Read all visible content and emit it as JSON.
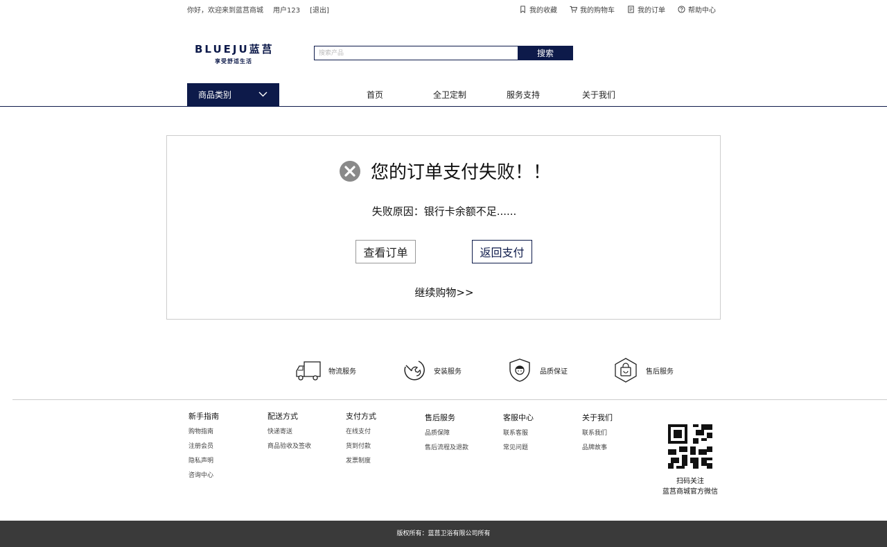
{
  "topbar": {
    "greeting": "你好，欢迎来到蓝莒商城",
    "username": "用户123",
    "logout": "[退出]",
    "favorites": "我的收藏",
    "cart": "我的购物车",
    "orders": "我的订单",
    "help": "帮助中心"
  },
  "logo": {
    "brand": "BLUEJU蓝莒",
    "slogan": "享受舒适生活"
  },
  "search": {
    "placeholder": "搜索产品",
    "button": "搜索"
  },
  "nav": {
    "category": "商品类别",
    "items": [
      "首页",
      "全卫定制",
      "服务支持",
      "关于我们"
    ]
  },
  "result": {
    "title": "您的订单支付失败！！",
    "reason": "失败原因：银行卡余额不足......",
    "view_order": "查看订单",
    "back_to_pay": "返回支付",
    "continue": "继续购物>>"
  },
  "services": [
    "物流服务",
    "安装服务",
    "品质保证",
    "售后服务"
  ],
  "footer": {
    "columns": [
      {
        "head": "新手指南",
        "items": [
          "购物指南",
          "注册会员",
          "隐私声明",
          "咨询中心"
        ]
      },
      {
        "head": "配送方式",
        "items": [
          "快递寄送",
          "商品验收及签收"
        ]
      },
      {
        "head": "支付方式",
        "items": [
          "在线支付",
          "货到付款",
          "发票制度"
        ]
      },
      {
        "head": "售后服务",
        "items": [
          "品质保障",
          "售后流程及退款"
        ]
      },
      {
        "head": "客服中心",
        "items": [
          "联系客服",
          "常见问题"
        ]
      },
      {
        "head": "关于我们",
        "items": [
          "联系我们",
          "品牌故事"
        ]
      }
    ],
    "qr_line1": "扫码关注",
    "qr_line2": "蓝莒商城官方微信",
    "copyright": "版权所有：蓝莒卫浴有限公司所有"
  },
  "colors": {
    "brand": "#0d1a4a",
    "footer_bg": "#3a3a3a",
    "fail_icon": "#8a8a8a"
  }
}
